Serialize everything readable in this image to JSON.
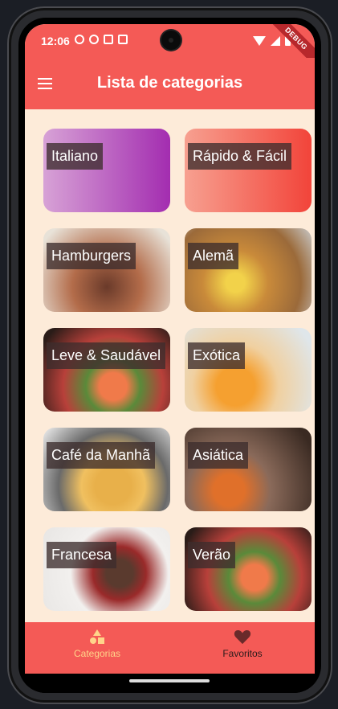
{
  "status_bar": {
    "time": "12:06",
    "debug_banner": "DEBUG"
  },
  "app_bar": {
    "title": "Lista de categorias",
    "menu_icon": "hamburger-menu-icon"
  },
  "categories": [
    {
      "label": "Italiano",
      "bg": "#c065c0"
    },
    {
      "label": "Rápido & Fácil",
      "bg": "#f56b5a"
    },
    {
      "label": "Hamburgers",
      "bg": "#a55b3c"
    },
    {
      "label": "Alemã",
      "bg": "#c48a3a"
    },
    {
      "label": "Leve & Saudável",
      "bg": "#8a4a2a"
    },
    {
      "label": "Exótica",
      "bg": "#d08a3a"
    },
    {
      "label": "Café da Manhã",
      "bg": "#b09060"
    },
    {
      "label": "Asiática",
      "bg": "#5a3f2e"
    },
    {
      "label": "Francesa",
      "bg": "#d8d4d2"
    },
    {
      "label": "Verão",
      "bg": "#7a4a30"
    }
  ],
  "bottom_nav": {
    "items": [
      {
        "label": "Categorias",
        "icon": "category-shapes-icon",
        "active": true
      },
      {
        "label": "Favoritos",
        "icon": "heart-icon",
        "active": false
      }
    ]
  }
}
